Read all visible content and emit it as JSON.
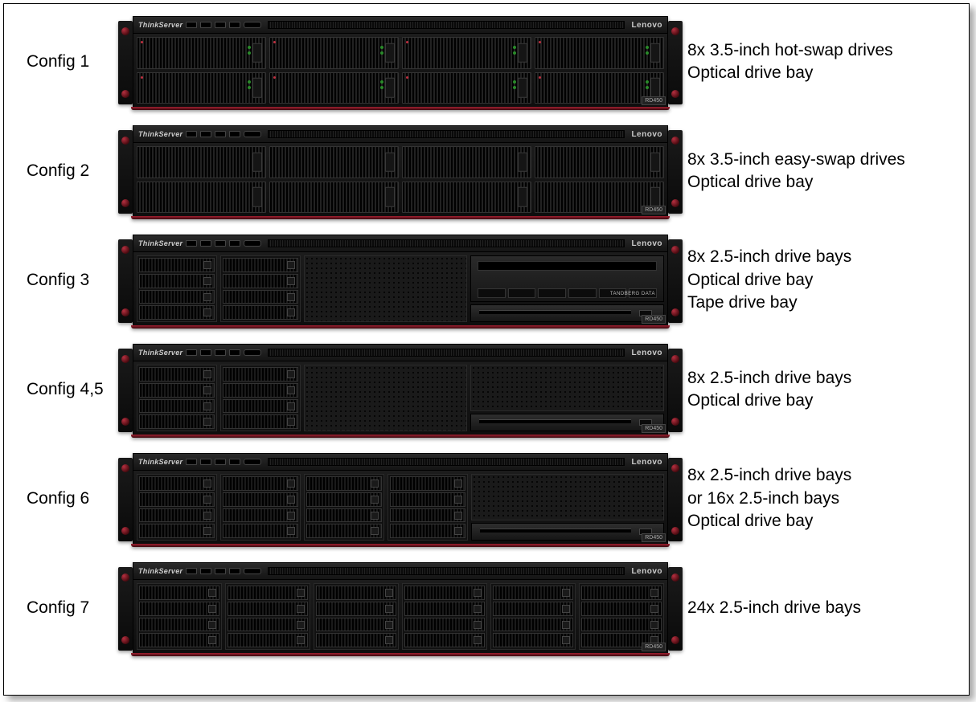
{
  "brand_left": "ThinkServer",
  "brand_right": "Lenovo",
  "model": "RD450",
  "tape_brand": "TANDBERG DATA",
  "configs": [
    {
      "label": "Config 1",
      "desc": "8x 3.5-inch hot-swap drives\nOptical drive bay",
      "type": "c1"
    },
    {
      "label": "Config 2",
      "desc": "8x 3.5-inch easy-swap drives\nOptical drive bay",
      "type": "c2"
    },
    {
      "label": "Config 3",
      "desc": "8x 2.5-inch drive bays\nOptical drive bay\nTape drive bay",
      "type": "c3"
    },
    {
      "label": "Config 4,5",
      "desc": "8x 2.5-inch drive bays\nOptical drive bay",
      "type": "c45"
    },
    {
      "label": "Config 6",
      "desc": "8x 2.5-inch drive bays\nor 16x 2.5-inch bays\nOptical drive bay",
      "type": "c6"
    },
    {
      "label": "Config 7",
      "desc": "24x 2.5-inch drive bays",
      "type": "c7"
    }
  ]
}
